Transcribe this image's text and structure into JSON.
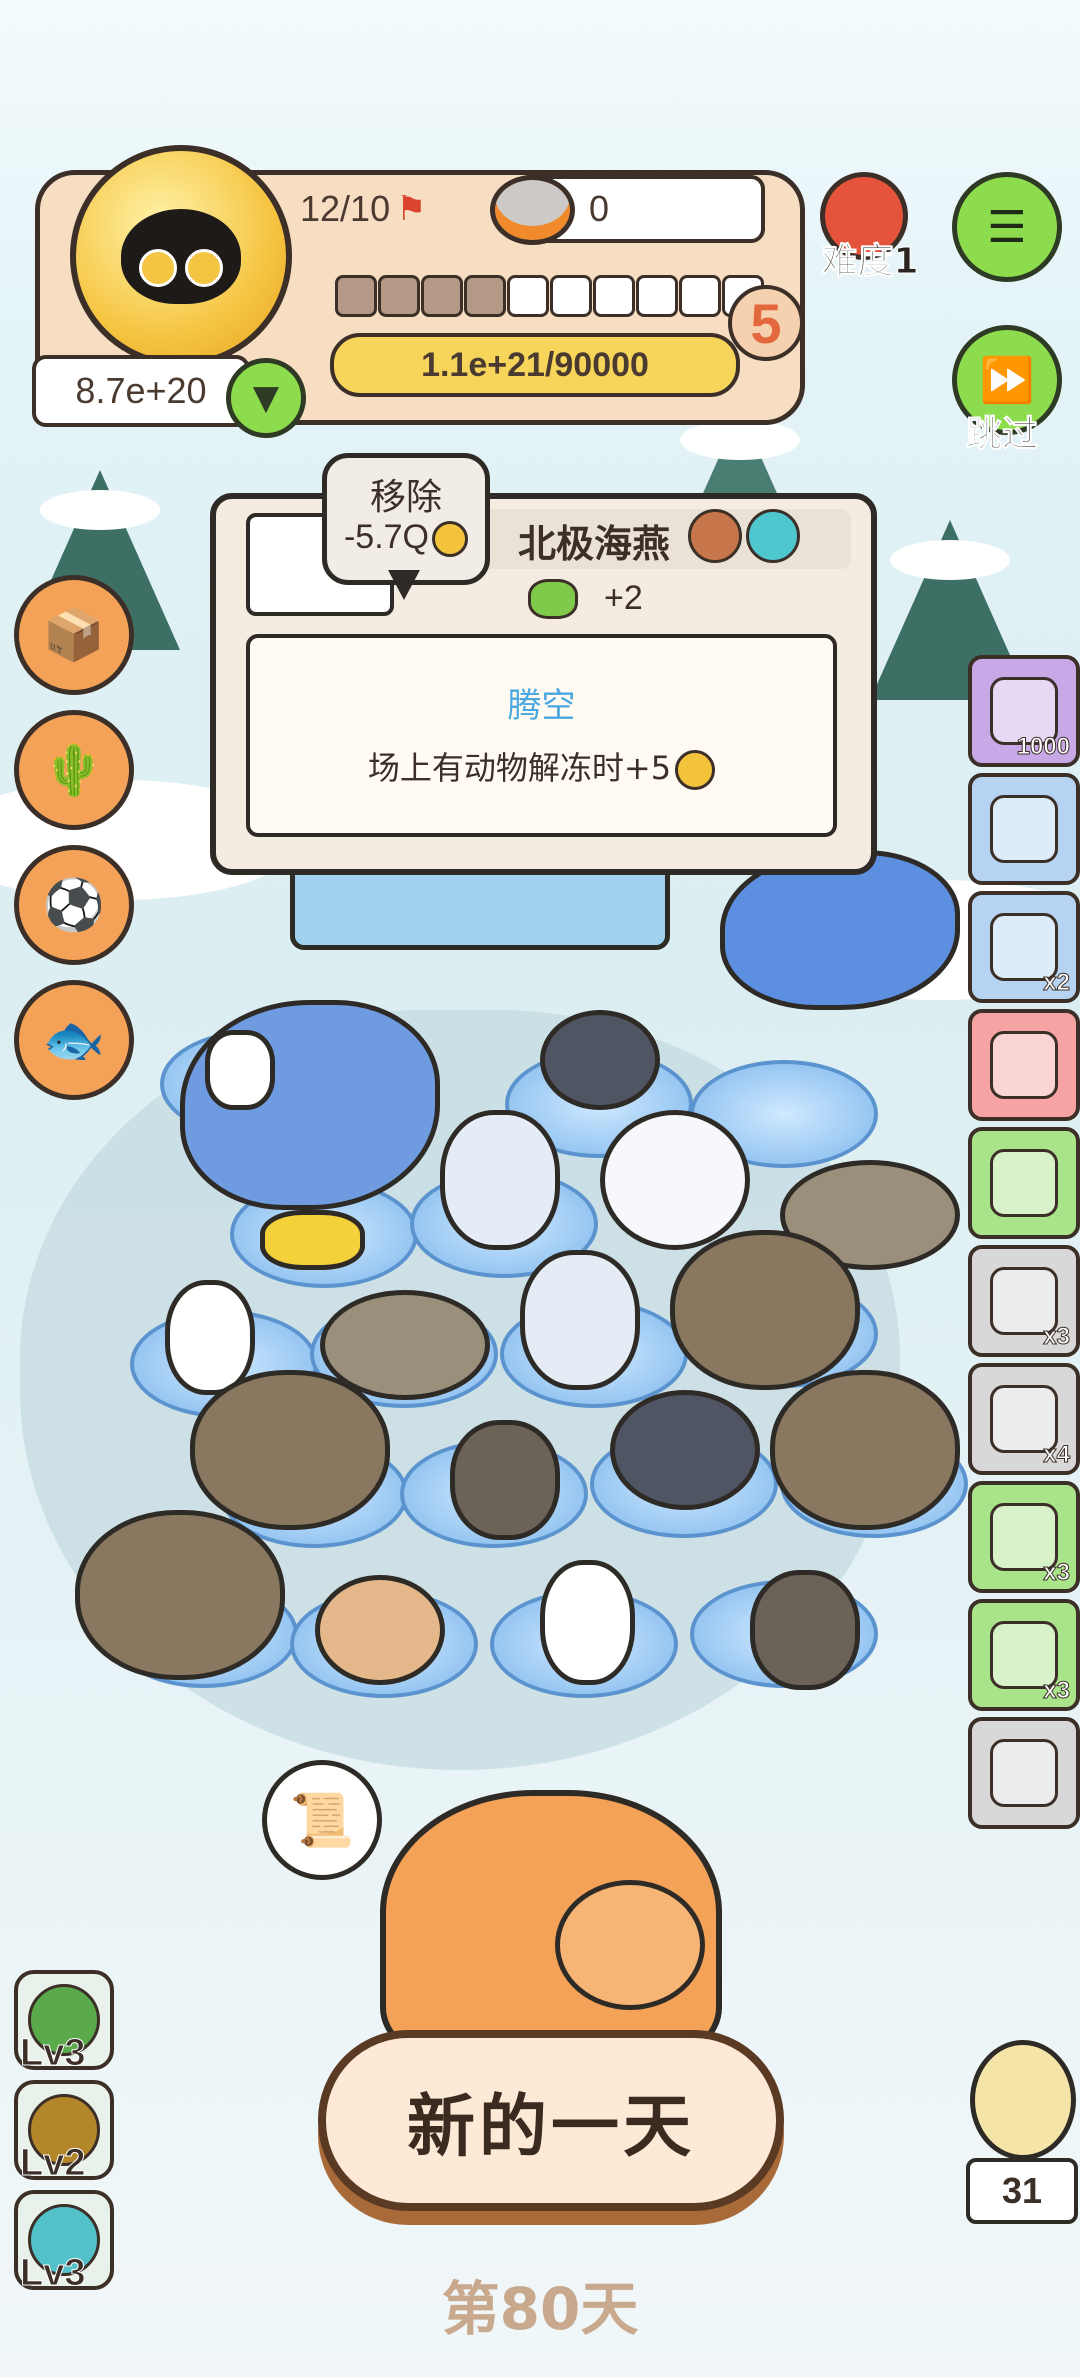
{
  "hud": {
    "capacity": "12/10",
    "food_count": "0",
    "difficulty_label": "难度1",
    "level_number": "5",
    "progress_text": "1.1e+21/90000",
    "coin_value": "8.7e+20",
    "filled_segments": 4,
    "total_segments": 10
  },
  "controls": {
    "skip_label": "跳过"
  },
  "tooltip": {
    "remove_label": "移除",
    "remove_cost": "-5.7Q",
    "animal_name": "北极海燕",
    "food_bonus": "+2",
    "skill_name": "腾空",
    "skill_desc": "场上有动物解冻时+5"
  },
  "right_items": [
    {
      "icon": "rock-pile-icon",
      "label": "1000",
      "color": "#c9a8e8"
    },
    {
      "icon": "ice-skate-icon",
      "label": "",
      "color": "#b7d3f2"
    },
    {
      "icon": "fireplace-icon",
      "label": "x2",
      "color": "#b7d3f2"
    },
    {
      "icon": "gingerbread-icon",
      "label": "",
      "color": "#f5a3a3"
    },
    {
      "icon": "snow-globe-icon",
      "label": "",
      "color": "#a9e38a"
    },
    {
      "icon": "magnifier-icon",
      "label": "x3",
      "color": "#d8d8d8"
    },
    {
      "icon": "towel-icon",
      "label": "x4",
      "color": "#d8d8d8"
    },
    {
      "icon": "hot-cocoa-icon",
      "label": "x3",
      "color": "#a9e38a"
    },
    {
      "icon": "tent-icon",
      "label": "x3",
      "color": "#a9e38a"
    },
    {
      "icon": "feather-icon",
      "label": "",
      "color": "#d8d8d8"
    }
  ],
  "level_badges": [
    {
      "icon": "green-orb-icon",
      "label": "Lv3",
      "color": "#5aa94a"
    },
    {
      "icon": "gold-orb-icon",
      "label": "Lv2",
      "color": "#b3862a"
    },
    {
      "icon": "ice-orb-icon",
      "label": "Lv3",
      "color": "#53c1c9"
    }
  ],
  "bottom": {
    "new_day_label": "新的一天",
    "day_label": "第80天",
    "owl_count": "31"
  }
}
